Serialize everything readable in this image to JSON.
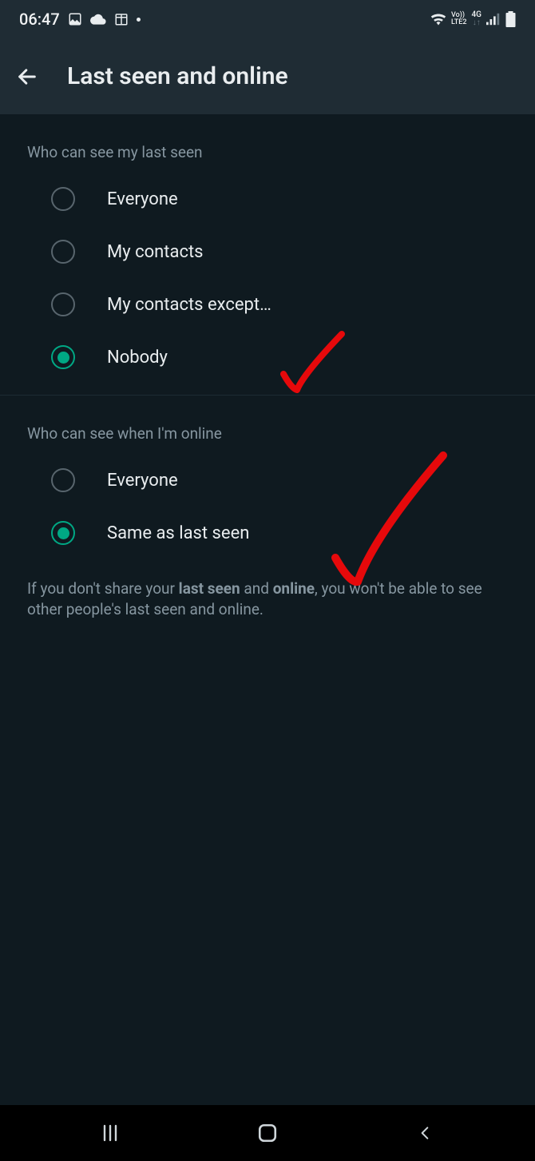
{
  "status": {
    "time": "06:47",
    "network_label": "LTE2",
    "volte_label": "Vo))",
    "data_label": "4G"
  },
  "header": {
    "title": "Last seen and online"
  },
  "section1": {
    "title": "Who can see my last seen",
    "options": [
      {
        "label": "Everyone",
        "selected": false
      },
      {
        "label": "My contacts",
        "selected": false
      },
      {
        "label": "My contacts except…",
        "selected": false
      },
      {
        "label": "Nobody",
        "selected": true
      }
    ]
  },
  "section2": {
    "title": "Who can see when I'm online",
    "options": [
      {
        "label": "Everyone",
        "selected": false
      },
      {
        "label": "Same as last seen",
        "selected": true
      }
    ]
  },
  "help": {
    "pre": "If you don't share your ",
    "bold1": "last seen",
    "mid": " and ",
    "bold2": "online",
    "post": ", you won't be able to see other people's last seen and online."
  }
}
